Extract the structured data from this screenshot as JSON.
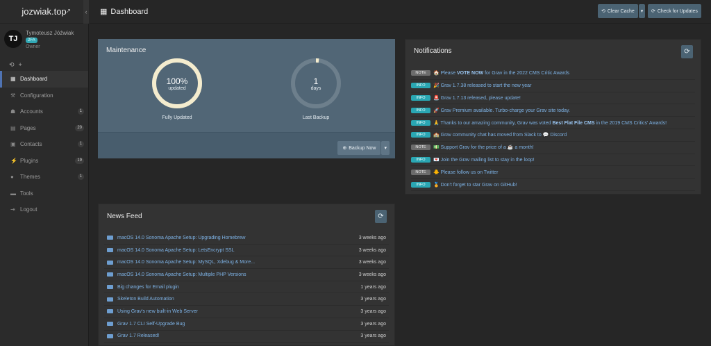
{
  "site": {
    "title": "jozwiak.top"
  },
  "user": {
    "initials": "TJ",
    "name": "Tymoteusz Jóźwiak",
    "badge": "2FA",
    "role": "Owner"
  },
  "sidebar": {
    "items": [
      {
        "label": "Dashboard",
        "icon": "dashboard-icon",
        "active": true
      },
      {
        "label": "Configuration",
        "icon": "wrench-icon"
      },
      {
        "label": "Accounts",
        "icon": "users-icon",
        "count": "1"
      },
      {
        "label": "Pages",
        "icon": "file-icon",
        "count": "20"
      },
      {
        "label": "Contacts",
        "icon": "contacts-icon",
        "count": "1"
      },
      {
        "label": "Plugins",
        "icon": "plug-icon",
        "count": "19"
      },
      {
        "label": "Themes",
        "icon": "tint-icon",
        "count": "1"
      },
      {
        "label": "Tools",
        "icon": "briefcase-icon"
      },
      {
        "label": "Logout",
        "icon": "logout-icon"
      }
    ]
  },
  "topbar": {
    "title": "Dashboard",
    "clear_cache": "Clear Cache",
    "check_updates": "Check for Updates"
  },
  "maintenance": {
    "title": "Maintenance",
    "updated_value": "100%",
    "updated_unit": "updated",
    "updated_fraction": 1.0,
    "updated_label": "Fully Updated",
    "backup_value": "1",
    "backup_unit": "days",
    "backup_fraction": 0.02,
    "backup_label": "Last Backup",
    "backup_button": "Backup Now"
  },
  "notifications": {
    "title": "Notifications",
    "items": [
      {
        "type": "NOTE",
        "html": "🏠 Please <b>VOTE NOW</b> for Grav in the 2022 CMS Critic Awards"
      },
      {
        "type": "INFO",
        "html": "🎉 Grav 1.7.38 released to start the new year"
      },
      {
        "type": "INFO",
        "html": "🚨 Grav 1.7.13 released, please update!"
      },
      {
        "type": "INFO",
        "html": "🚀 Grav Premium available. Turbo-charge your Grav site today."
      },
      {
        "type": "INFO",
        "html": "🙏 Thanks to our amazing community, Grav was voted <b>Best Flat File CMS</b> in the 2019 CMS Critics' Awards!"
      },
      {
        "type": "INFO",
        "html": "🏫 Grav community chat has moved from Slack to 💬 Discord"
      },
      {
        "type": "NOTE",
        "html": "💵 Support Grav for the price of a ☕ a month!"
      },
      {
        "type": "INFO",
        "html": "💌 Join the Grav mailing list to stay in the loop!"
      },
      {
        "type": "NOTE",
        "html": "🐥 Please follow us on Twitter"
      },
      {
        "type": "INFO",
        "html": "🏅 Don't forget to star Grav on GitHub!"
      }
    ]
  },
  "news": {
    "title": "News Feed",
    "items": [
      {
        "title": "macOS 14.0 Sonoma Apache Setup: Upgrading Homebrew",
        "date": "3 weeks ago"
      },
      {
        "title": "macOS 14.0 Sonoma Apache Setup: LetsEncrypt SSL",
        "date": "3 weeks ago"
      },
      {
        "title": "macOS 14.0 Sonoma Apache Setup: MySQL, Xdebug & More...",
        "date": "3 weeks ago"
      },
      {
        "title": "macOS 14.0 Sonoma Apache Setup: Multiple PHP Versions",
        "date": "3 weeks ago"
      },
      {
        "title": "Big changes for Email plugin",
        "date": "1 years ago"
      },
      {
        "title": "Skeleton Build Automation",
        "date": "3 years ago"
      },
      {
        "title": "Using Grav's new built-in Web Server",
        "date": "3 years ago"
      },
      {
        "title": "Grav 1.7 CLI Self-Upgrade Bug",
        "date": "3 years ago"
      },
      {
        "title": "Grav 1.7 Released!",
        "date": "3 years ago"
      }
    ]
  },
  "colors": {
    "accent": "#4b6373",
    "ring": "#f4ecce",
    "ring_track": "#6d7f8c",
    "info": "#2aa7b3",
    "link": "#7eb3e6"
  }
}
